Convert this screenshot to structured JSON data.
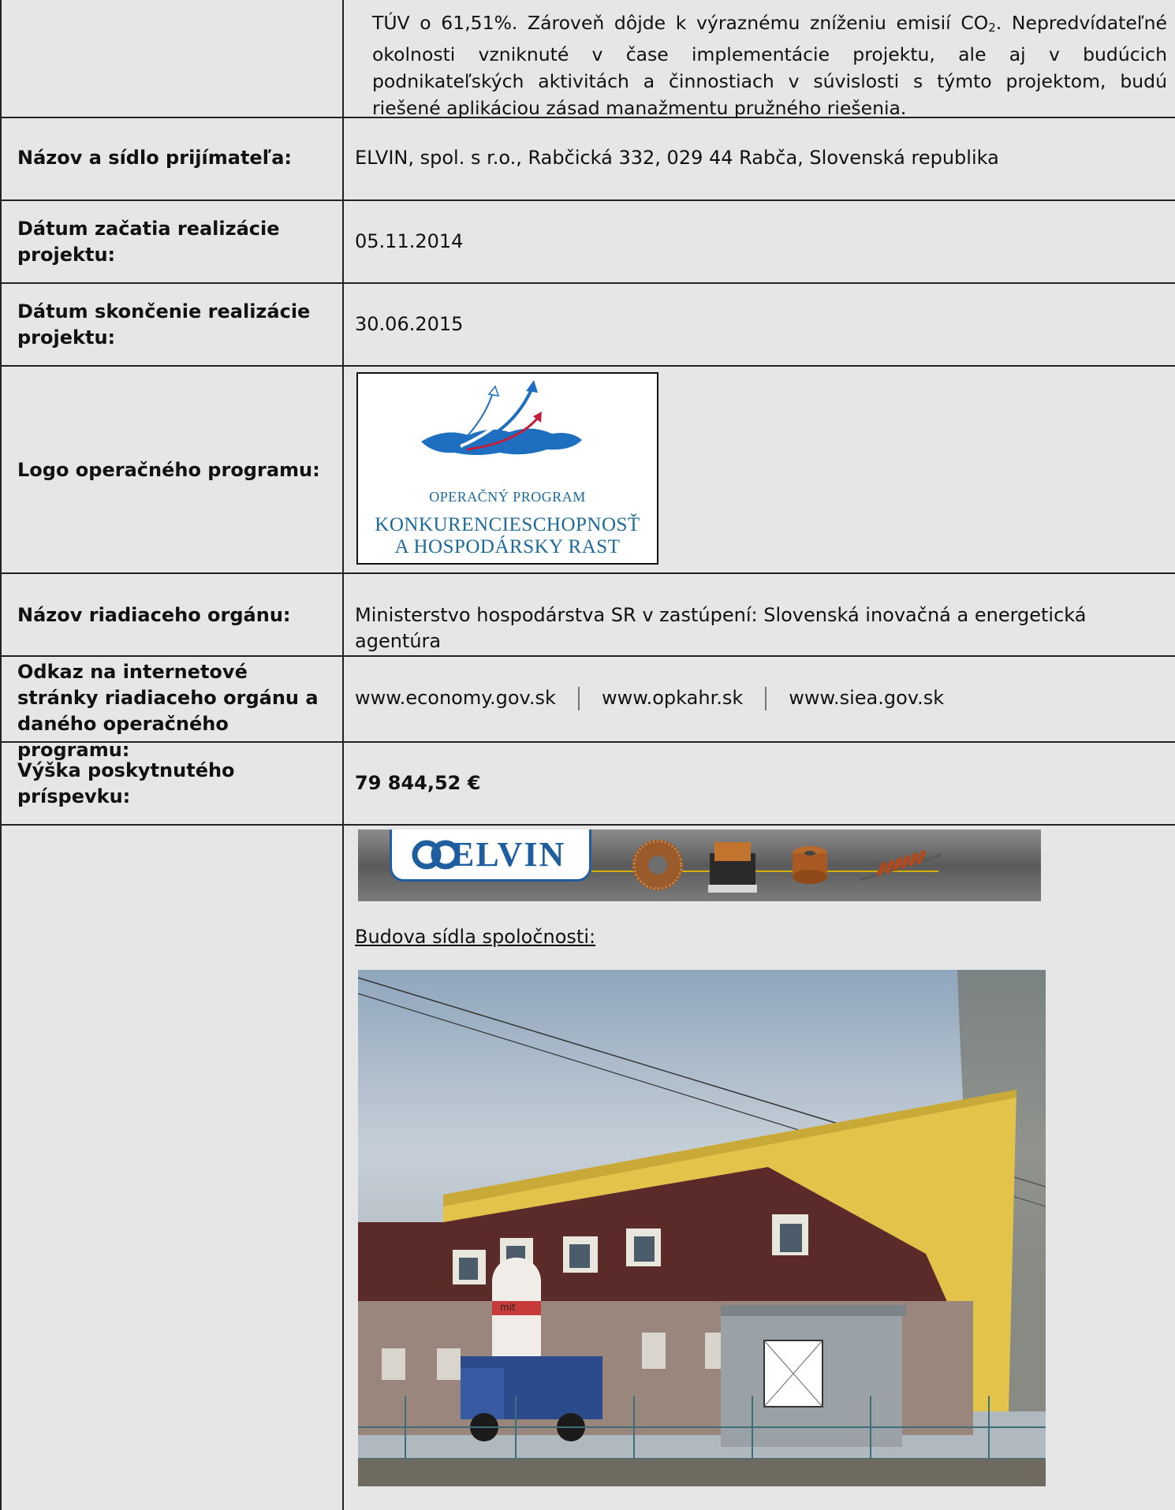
{
  "intro_text": {
    "line1_pre": "TÚV o 61,51%. Zároveň dôjde k výraznému zníženiu emisií CO",
    "line1_sub": "2",
    "line1_post": ". Nepredvídateľné okolnosti vzniknuté v čase implementácie projektu, ale aj v budúcich podnikateľských aktivitách a činnostiach v súvislosti s týmto projektom, budú riešené aplikáciou zásad manažmentu pružného riešenia."
  },
  "rows": {
    "recipient": {
      "label": "Názov a sídlo prijímateľa:",
      "value": "ELVIN, spol. s r.o., Rabčická 332, 029 44 Rabča, Slovenská republika"
    },
    "start_date": {
      "label": "Dátum začatia realizácie projektu:",
      "value": "05.11.2014"
    },
    "end_date": {
      "label": "Dátum skončenie realizácie projektu:",
      "value": "30.06.2015"
    },
    "logo": {
      "label": "Logo operačného programu:",
      "logo_line1": "OPERAČNÝ PROGRAM",
      "logo_line2": "KONKURENCIESCHOPNOSŤ",
      "logo_line3": "A HOSPODÁRSKY RAST"
    },
    "authority": {
      "label": "Názov riadiaceho orgánu:",
      "value": "Ministerstvo hospodárstva SR v zastúpení: Slovenská inovačná a energetická agentúra"
    },
    "links": {
      "label": "Odkaz na internetové stránky riadiaceho orgánu a daného operačného programu:",
      "items": [
        "www.economy.gov.sk",
        "www.opkahr.sk",
        "www.siea.gov.sk"
      ]
    },
    "amount": {
      "label": "Výška poskytnutého príspevku:",
      "value": "79 844,52 €"
    },
    "gallery": {
      "banner_text": "ELVIN",
      "caption": "Budova sídla spoločnosti:",
      "photo_sign_text": "mit"
    }
  },
  "colors": {
    "cell_bg": "#e6e6e6",
    "border": "#222222",
    "logo_blue": "#1d6a9a",
    "elvin_blue": "#1f5e9e"
  }
}
